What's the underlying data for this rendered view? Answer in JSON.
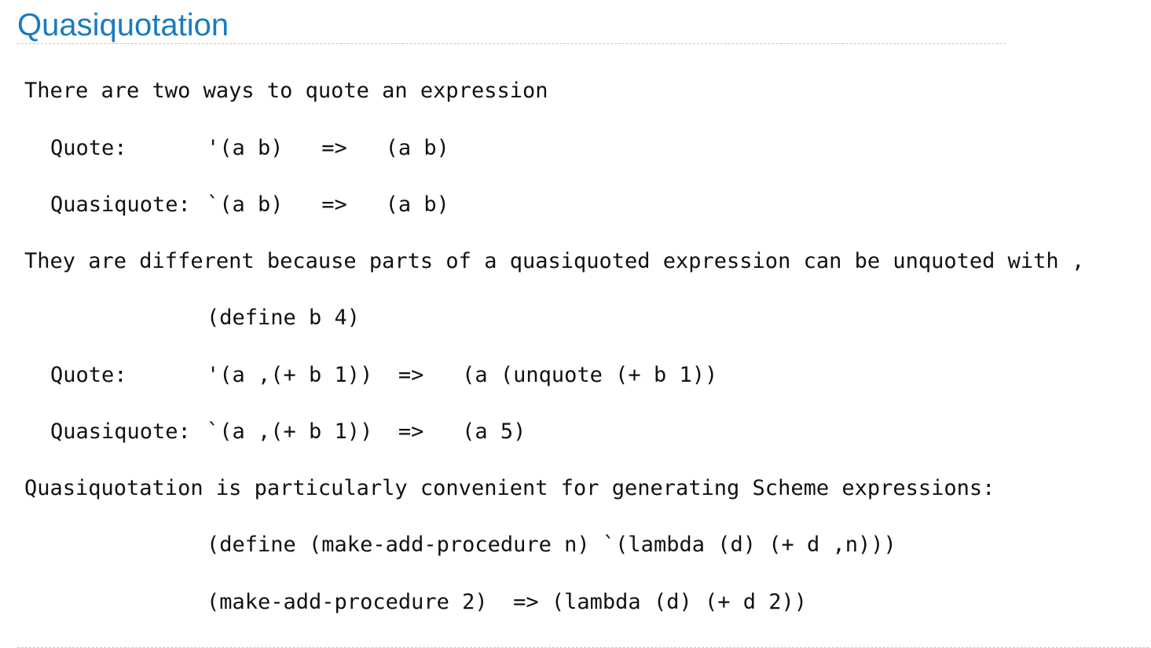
{
  "title": "Quasiquotation",
  "intro": "There are two ways to quote an expression",
  "example1": {
    "quote_label": "Quote:",
    "quote_code": "'(a b)   =>   (a b)",
    "quasi_label": "Quasiquote:",
    "quasi_code": "`(a b)   =>   (a b)"
  },
  "difference": "They are different because parts of a quasiquoted expression can be unquoted with ,",
  "example2": {
    "define_code": "(define b 4)",
    "quote_label": "Quote:",
    "quote_code": "'(a ,(+ b 1))  =>   (a (unquote (+ b 1))",
    "quasi_label": "Quasiquote:",
    "quasi_code": "`(a ,(+ b 1))  =>   (a 5)"
  },
  "convenience": "Quasiquotation is particularly convenient for generating Scheme expressions:",
  "example3": {
    "define_code": "(define (make-add-procedure n) `(lambda (d) (+ d ,n)))",
    "call_code": "(make-add-procedure 2)  => (lambda (d) (+ d 2))"
  }
}
